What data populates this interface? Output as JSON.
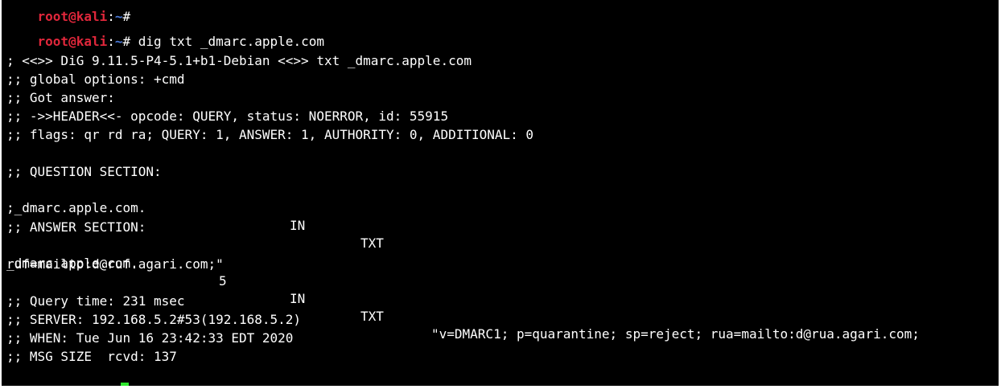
{
  "terminal": {
    "prev_prompt": {
      "user": "root@kali",
      "colon": ":",
      "path": "~",
      "symbol": "#"
    },
    "prompt": {
      "user": "root@kali",
      "colon": ":",
      "path": "~",
      "symbol": "# ",
      "command": "dig txt _dmarc.apple.com"
    },
    "header_lines": [
      "; <<>> DiG 9.11.5-P4-5.1+b1-Debian <<>> txt _dmarc.apple.com",
      ";; global options: +cmd",
      ";; Got answer:",
      ";; ->>HEADER<<- opcode: QUERY, status: NOERROR, id: 55915",
      ";; flags: qr rd ra; QUERY: 1, ANSWER: 1, AUTHORITY: 0, ADDITIONAL: 0"
    ],
    "question_section": {
      "title": ";; QUESTION SECTION:",
      "name": ";_dmarc.apple.com.",
      "class": "IN",
      "type": "TXT"
    },
    "answer_section": {
      "title": ";; ANSWER SECTION:",
      "name": "_dmarc.apple.com.",
      "ttl": "5",
      "class": "IN",
      "type": "TXT",
      "value": "\"v=DMARC1; p=quarantine; sp=reject; rua=mailto:d@rua.agari.com;",
      "value_cont": "ruf=mailto:d@ruf.agari.com;\""
    },
    "footer_lines": [
      ";; Query time: 231 msec",
      ";; SERVER: 192.168.5.2#53(192.168.5.2)",
      ";; WHEN: Tue Jun 16 23:42:33 EDT 2020",
      ";; MSG SIZE  rcvd: 137"
    ],
    "colors": {
      "background": "#000000",
      "text": "#ffffff",
      "prompt_user": "#e0273b",
      "prompt_path": "#4a79d8",
      "cursor": "#2ee82e"
    }
  }
}
